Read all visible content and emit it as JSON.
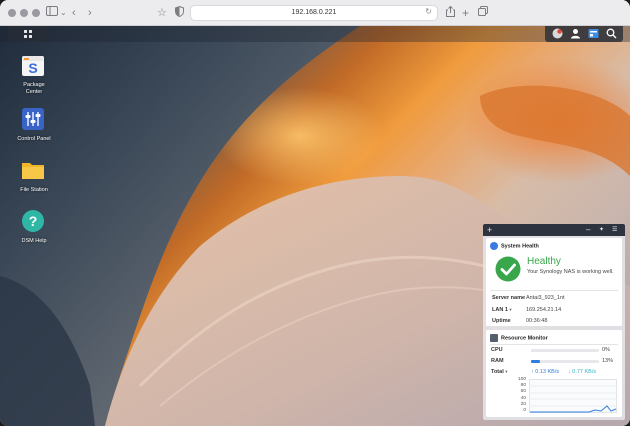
{
  "browser": {
    "url": "192.168.0.221",
    "icons": [
      "sidebar-icon",
      "chevron-down-icon",
      "back-icon",
      "forward-icon",
      "bookmark-star-icon",
      "shield-icon",
      "reload-icon",
      "share-icon",
      "new-tab-icon",
      "tabs-overview-icon"
    ]
  },
  "desktop": {
    "apps": [
      {
        "label": "Package\nCenter",
        "icon": "package-center-icon"
      },
      {
        "label": "Control Panel",
        "icon": "control-panel-icon"
      },
      {
        "label": "File Station",
        "icon": "folder-icon"
      },
      {
        "label": "DSM Help",
        "icon": "help-icon"
      }
    ],
    "tray_icons": [
      "chat-icon",
      "user-icon",
      "widgets-icon",
      "search-icon"
    ]
  },
  "widgets": {
    "toolbar": {
      "add": "+",
      "minimize": "–",
      "pin": "✦",
      "settings": "☰"
    },
    "system_health": {
      "title": "System Health",
      "status": "Healthy",
      "description": "Your Synology NAS is working well.",
      "rows": [
        {
          "key": "Server name",
          "value": "Antai3_923_1nt"
        },
        {
          "key": "LAN 1",
          "value": "169.254.21.14"
        },
        {
          "key": "Uptime",
          "value": "00:36:48"
        }
      ],
      "status_color": "#3aa64b"
    },
    "resource_monitor": {
      "title": "Resource Monitor",
      "cpu": {
        "label": "CPU",
        "percent": 0,
        "text": "0%"
      },
      "ram": {
        "label": "RAM",
        "percent": 13,
        "text": "13%"
      },
      "total": {
        "label": "Total",
        "up": "0.13 KB/s",
        "down": "0.77 KB/s"
      },
      "chart_ticks": [
        "100",
        "80",
        "60",
        "40",
        "20",
        "0"
      ],
      "accent_color": "#2f7ee0",
      "down_color": "#34b3c7"
    }
  }
}
